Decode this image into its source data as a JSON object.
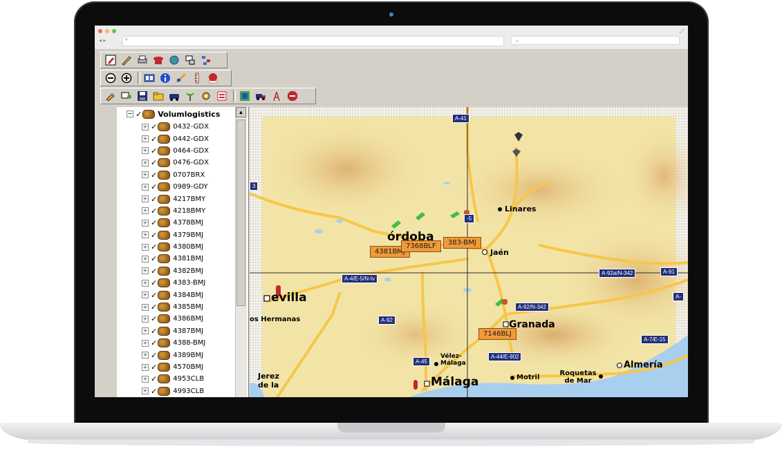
{
  "browser": {
    "nav": "◂ ▸",
    "new_tab": "+",
    "search_icon": "⌕"
  },
  "tree": {
    "root_label": "Volumlogistics",
    "vehicles": [
      "0432-GDX",
      "0442-GDX",
      "0464-GDX",
      "0476-GDX",
      "0707BRX",
      "0989-GDY",
      "4217BMY",
      "4218BMY",
      "4378BMJ",
      "4379BMJ",
      "4380BMJ",
      "4381BMJ",
      "4382BMJ",
      "4383-BMJ",
      "4384BMJ",
      "4385BMJ",
      "4386BMJ",
      "4387BMJ",
      "4388-BMJ",
      "4389BMJ",
      "4570BMJ",
      "4953CLB",
      "4993CLB"
    ]
  },
  "map": {
    "cities": {
      "cordoba": "órdoba",
      "sevilla": "evilla",
      "granada": "Granada",
      "jaen": "Jaén",
      "linares": "Linares",
      "malaga": "Málaga",
      "almeria": "Almería",
      "motril": "Motril",
      "roquetas": "Roquetas de Mar",
      "dos_hermanas": "os Hermanas",
      "jerez": "Jerez de la",
      "velez": "Vélez- Málaga"
    },
    "roads": {
      "a41": "A-41",
      "a4": "A-4/E-5/N-Iv",
      "a92": "A-92",
      "a92n342": "A-92/N-342",
      "a92n342b": "A-92a/N-342",
      "a91": "A-91",
      "a45": "A-45",
      "a44": "A-44/E-902",
      "a7": "A-7/E-15",
      "a5": "-5",
      "a3": "3",
      "a_right": "A-"
    },
    "vehicle_tags": {
      "t4381": "4381BMJ",
      "t7368": "7368BLF",
      "t383": "383-BMJ",
      "t7146": "7146BLJ"
    },
    "colors": {
      "land": "#f2e4a6",
      "relief": "#e8c98a",
      "water": "#a9cfee",
      "road": "#f7c64a",
      "shield": "#1f2f7a",
      "tag": "#f09a3a"
    }
  }
}
